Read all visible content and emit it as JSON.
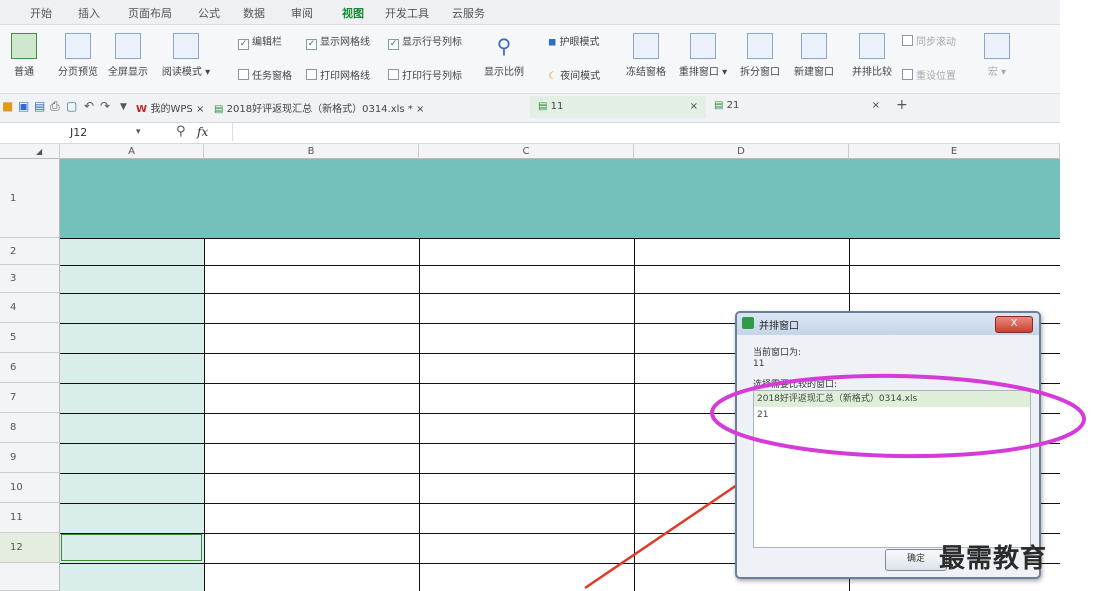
{
  "menu": [
    "开始",
    "插入",
    "页面布局",
    "公式",
    "数据",
    "审阅",
    "视图",
    "开发工具",
    "云服务"
  ],
  "menu_active_index": 6,
  "ribbon": {
    "big_buttons": [
      "普通",
      "分页预览",
      "全屏显示",
      "阅读模式 ▾"
    ],
    "checks_row1": [
      {
        "label": "编辑栏",
        "checked": true
      },
      {
        "label": "显示网格线",
        "checked": true
      },
      {
        "label": "显示行号列标",
        "checked": true
      }
    ],
    "checks_row2": [
      {
        "label": "任务窗格",
        "checked": false
      },
      {
        "label": "打印网格线",
        "checked": false
      },
      {
        "label": "打印行号列标",
        "checked": false
      }
    ],
    "zoom_label": "显示比例",
    "eye_mode": "护眼模式",
    "night_mode": "夜间模式",
    "right_buttons": [
      "冻结窗格",
      "重排窗口 ▾",
      "拆分窗口",
      "新建窗口",
      "并排比较"
    ],
    "sync_scroll": "同步滚动",
    "reset_pos": "重设位置",
    "last_button": "宏 ▾"
  },
  "tabs": {
    "wps": "我的WPS",
    "file1": "2018好评返现汇总（新格式）0314.xls *",
    "file2": "11",
    "file3": "21",
    "close_glyph": "×",
    "plus": "+"
  },
  "formula_bar": {
    "cell_ref": "J12",
    "fx": "fx",
    "value": ""
  },
  "columns": [
    "A",
    "B",
    "C",
    "D",
    "E"
  ],
  "rows": [
    "1",
    "2",
    "3",
    "4",
    "5",
    "6",
    "7",
    "8",
    "9",
    "10",
    "11",
    "12"
  ],
  "dialog": {
    "title": "并排窗口",
    "current_label": "当前窗口为:",
    "current_value": "11",
    "select_label": "选择需要比较的窗口:",
    "options": [
      "2018好评返现汇总（新格式）0314.xls",
      "21"
    ],
    "ok": "确定",
    "close": "X"
  },
  "watermark": "最需教育",
  "colors": {
    "header_fill": "#74c1bc",
    "col_a_fill": "#d9edeb",
    "ellipse": "#d63ad8",
    "arrow": "#e03a2a"
  }
}
